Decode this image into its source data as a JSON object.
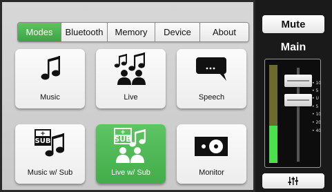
{
  "tabs": [
    {
      "label": "Modes",
      "active": true
    },
    {
      "label": "Bluetooth",
      "active": false
    },
    {
      "label": "Memory",
      "active": false
    },
    {
      "label": "Device",
      "active": false
    },
    {
      "label": "About",
      "active": false
    }
  ],
  "modes": [
    {
      "label": "Music",
      "icon": "music-note-icon",
      "active": false
    },
    {
      "label": "Live",
      "icon": "live-band-icon",
      "active": false
    },
    {
      "label": "Speech",
      "icon": "speech-bubble-icon",
      "active": false
    },
    {
      "label": "Music w/ Sub",
      "icon": "music-sub-icon",
      "active": false
    },
    {
      "label": "Live w/ Sub",
      "icon": "live-sub-icon",
      "active": true
    },
    {
      "label": "Monitor",
      "icon": "monitor-speaker-icon",
      "active": false
    }
  ],
  "mute_label": "Mute",
  "main_label": "Main",
  "scale_ticks": [
    "• 10",
    "• 5",
    "• U",
    "• 5",
    "• 10",
    "• 20",
    "• 40"
  ],
  "meter_level": 0.38,
  "colors": {
    "accent": "#4cb853",
    "panel": "#d3d3d3",
    "dark": "#1a1a1a"
  }
}
